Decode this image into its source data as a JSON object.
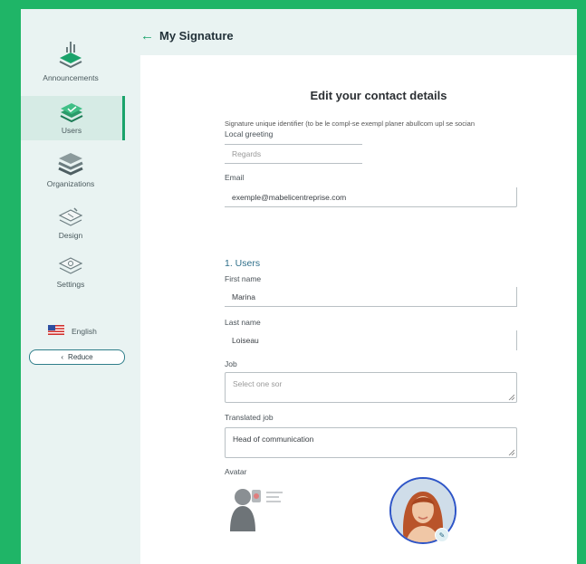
{
  "header": {
    "title": "My Signature"
  },
  "sidebar": {
    "items": [
      {
        "label": "Announcements",
        "icon": "megaphone-chart-icon"
      },
      {
        "label": "Users",
        "icon": "users-layers-icon",
        "active": true
      },
      {
        "label": "Organizations",
        "icon": "layers-icon"
      },
      {
        "label": "Design",
        "icon": "design-layers-icon"
      },
      {
        "label": "Settings",
        "icon": "settings-layers-icon"
      }
    ],
    "language": "English",
    "reduce_label": "Reduce"
  },
  "main": {
    "heading": "Edit your contact details",
    "signature_note": "Signature unique identifier (to be le compl-se exempl planer abullcom upl se socian",
    "local_greeting_label": "Local greeting",
    "local_greeting_placeholder": "Regards",
    "email_label": "Email",
    "email_value": "exemple@mabelicentreprise.com",
    "section_title": "1. Users",
    "first_name_label": "First name",
    "first_name_value": "Marina",
    "last_name_label": "Last name",
    "last_name_value": "Loiseau",
    "job_label": "Job",
    "job_placeholder": "Select one sor",
    "translated_job_label": "Translated job",
    "translated_job_value": "Head of communication",
    "avatar_label": "Avatar"
  },
  "colors": {
    "accent": "#1aa36b",
    "background": "#1fb567",
    "sidebar": "#e9f3f2"
  }
}
